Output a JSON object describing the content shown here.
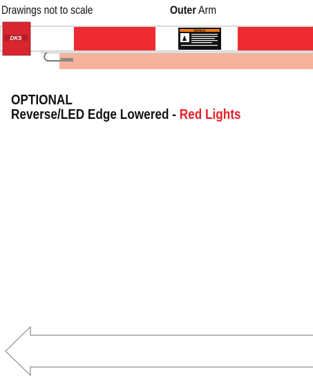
{
  "header": {
    "note": "Drawings not to scale",
    "arm_bold": "Outer",
    "arm_rest": " Arm"
  },
  "arm": {
    "logo_text": "DKS",
    "warning_title": "WARNING",
    "colors": {
      "red": "#ee2a33",
      "dark_red": "#c8202a",
      "white": "#ffffff",
      "led_glow": "#f6a98f"
    }
  },
  "section": {
    "line1": "OPTIONAL",
    "line2_prefix": "Reverse/LED Edge Lowered - ",
    "line2_highlight": "Red Lights"
  },
  "icons": {
    "arrow": "left-arrow-icon"
  }
}
